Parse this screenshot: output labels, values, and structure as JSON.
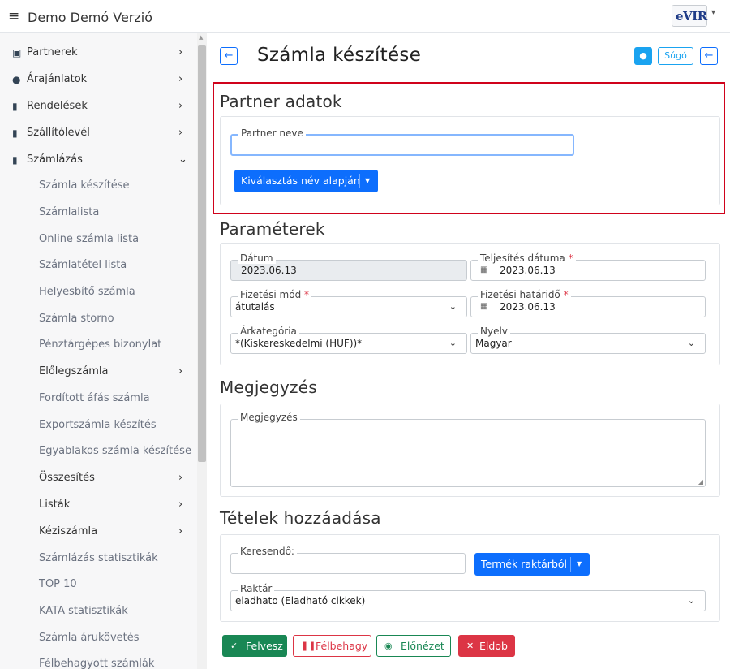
{
  "header": {
    "menu_icon": "≡",
    "app_title": "Demo Demó Verzió",
    "logo_text": "eVIR"
  },
  "sidebar": {
    "menu": [
      {
        "label": "Partnerek",
        "icon": "address-card-icon",
        "glyph": "▣"
      },
      {
        "label": "Árajánlatok",
        "icon": "users-icon",
        "glyph": "●"
      },
      {
        "label": "Rendelések",
        "icon": "file-icon",
        "glyph": "▮"
      },
      {
        "label": "Szállítólevél",
        "icon": "clipboard-icon",
        "glyph": "▮"
      },
      {
        "label": "Számlázás",
        "icon": "invoice-icon",
        "glyph": "▮"
      }
    ],
    "sub": [
      {
        "label": "Számla készítése"
      },
      {
        "label": "Számlalista"
      },
      {
        "label": "Online számla lista"
      },
      {
        "label": "Számlatétel lista"
      },
      {
        "label": "Helyesbítő számla"
      },
      {
        "label": "Számla storno"
      },
      {
        "label": "Pénztárgépes bizonylat"
      },
      {
        "label": "Előlegszámla"
      },
      {
        "label": "Fordított áfás számla"
      },
      {
        "label": "Exportszámla készítés"
      },
      {
        "label": "Egyablakos számla készítése"
      },
      {
        "label": "Összesítés"
      },
      {
        "label": "Listák"
      },
      {
        "label": "Kéziszámla"
      },
      {
        "label": "Számlázás statisztikák"
      },
      {
        "label": "TOP 10"
      },
      {
        "label": "KATA statisztikák"
      },
      {
        "label": "Számla árukövetés"
      },
      {
        "label": "Félbehagyott számlák"
      }
    ]
  },
  "page": {
    "title": "Számla készítése",
    "help_label": "Súgó"
  },
  "partner": {
    "section_title": "Partner adatok",
    "name_label": "Partner neve",
    "name_value": "",
    "select_button": "Kiválasztás név alapján"
  },
  "params": {
    "section_title": "Paraméterek",
    "date_label": "Dátum",
    "date_value": "2023.06.13",
    "fulfillment_label": "Teljesítés dátuma",
    "fulfillment_value": "2023.06.13",
    "payment_method_label": "Fizetési mód",
    "payment_method_value": "átutalás",
    "due_label": "Fizetési határidő",
    "due_value": "2023.06.13",
    "price_category_label": "Árkategória",
    "price_category_value": "*(Kiskereskedelmi (HUF))*",
    "language_label": "Nyelv",
    "language_value": "Magyar",
    "required_mark": "*"
  },
  "note": {
    "section_title": "Megjegyzés",
    "label": "Megjegyzés",
    "value": ""
  },
  "items": {
    "section_title": "Tételek hozzáadása",
    "search_label": "Keresendő:",
    "search_value": "",
    "product_button": "Termék raktárból",
    "warehouse_label": "Raktár",
    "warehouse_value": "eladhato (Eladható cikkek)"
  },
  "actions": {
    "save": "Felvesz",
    "pause": "Félbehagy",
    "preview": "Előnézet",
    "discard": "Eldob"
  },
  "colors": {
    "primary": "#0d6efd",
    "success": "#198754",
    "danger": "#dc3545",
    "highlight": "#d0021b",
    "info": "#1aa3f0"
  }
}
